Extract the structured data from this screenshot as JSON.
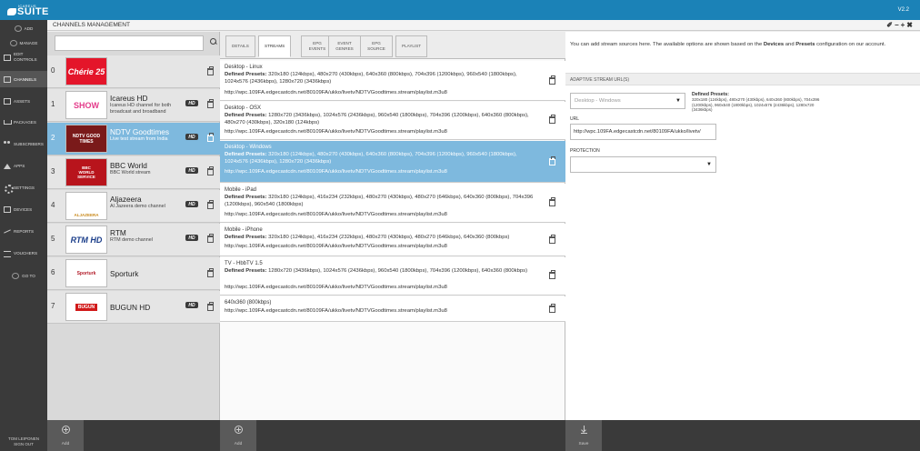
{
  "app": {
    "brand": "ICAREUS",
    "name": "SUITE",
    "version": "V2.2"
  },
  "sidebar": {
    "items": [
      {
        "label": "ADD",
        "icon": "plus-circle-icon"
      },
      {
        "label": "MANAGE",
        "icon": "manage-icon"
      },
      {
        "label": "EDIT CONTROLS",
        "icon": "edit-controls-icon"
      },
      {
        "label": "CHANNELS",
        "icon": "channels-icon"
      },
      {
        "label": "ASSETS",
        "icon": "assets-icon"
      },
      {
        "label": "PACKAGES",
        "icon": "cart-icon"
      },
      {
        "label": "SUBSCRIBERS",
        "icon": "subscribers-icon"
      },
      {
        "label": "APPS",
        "icon": "apps-icon"
      },
      {
        "label": "SETTINGS",
        "icon": "gear-icon"
      },
      {
        "label": "DEVICES",
        "icon": "devices-icon"
      },
      {
        "label": "REPORTS",
        "icon": "reports-icon"
      },
      {
        "label": "VOUCHERS",
        "icon": "vouchers-icon"
      },
      {
        "label": "GO TO",
        "icon": "goto-icon"
      }
    ],
    "user": {
      "name": "TOM LEIPONEN",
      "signout": "SIGN OUT"
    }
  },
  "header": {
    "title": "CHANNELS MANAGEMENT",
    "controls": "✕ − + ✖"
  },
  "channels": {
    "search_value": "",
    "items": [
      {
        "num": "0",
        "name": "",
        "desc": "",
        "hd": false,
        "logo_text": "Chérie 25"
      },
      {
        "num": "1",
        "name": "Icareus HD",
        "desc": "Icareus HD channel for both broadcast and broadband",
        "hd": true,
        "logo_text": "SHOW"
      },
      {
        "num": "2",
        "name": "NDTV Goodtimes",
        "desc": "Live test stream from India",
        "hd": true,
        "logo_text": "NDTV GOOD TIMES"
      },
      {
        "num": "3",
        "name": "BBC World",
        "desc": "BBC World stream",
        "hd": true,
        "logo_text": "BBC WORLD SERVICE"
      },
      {
        "num": "4",
        "name": "Aljazeera",
        "desc": "Al Jazeera demo channel",
        "hd": true,
        "logo_text": "ALJAZEERA"
      },
      {
        "num": "5",
        "name": "RTM",
        "desc": "RTM demo channel",
        "hd": true,
        "logo_text": "RTM HD"
      },
      {
        "num": "6",
        "name": "Sporturk",
        "desc": "",
        "hd": false,
        "logo_text": "Sporturk"
      },
      {
        "num": "7",
        "name": "BUGUN HD",
        "desc": "",
        "hd": true,
        "logo_text": "BUGUN"
      }
    ],
    "add_label": "Add"
  },
  "tabs": [
    {
      "label": "DETAILS"
    },
    {
      "label": "STREAMS"
    },
    {
      "label": "EPG EVENTS"
    },
    {
      "label": "EVENT GENRES"
    },
    {
      "label": "EPG SOURCE"
    },
    {
      "label": "PLAYLIST"
    }
  ],
  "streams": {
    "presets_label": "Defined Presets:",
    "items": [
      {
        "name": "Desktop - Linux",
        "presets": "320x180 (124kbps), 480x270 (430kbps), 640x360 (800kbps), 704x396 (1200kbps), 960x540 (1800kbps), 1024x576 (2436kbps), 1280x720 (3436kbps)",
        "url": "http://wpc.109FA.edgecastcdn.net/80109FA/ukko/livetv/NDTVGoodtimes.stream/playlist.m3u8"
      },
      {
        "name": "Desktop - OSX",
        "presets": "1280x720 (3436kbps), 1024x576 (2436kbps), 960x540 (1800kbps), 704x396 (1200kbps), 640x360 (800kbps), 480x270 (430kbps), 320x180 (124kbps)",
        "url": "http://wpc.109FA.edgecastcdn.net/80109FA/ukko/livetv/NDTVGoodtimes.stream/playlist.m3u8"
      },
      {
        "name": "Desktop - Windows",
        "presets": "320x180 (124kbps), 480x270 (430kbps), 640x360 (800kbps), 704x396 (1200kbps), 960x540 (1800kbps), 1024x576 (2436kbps), 1280x720 (3436kbps)",
        "url": "http://wpc.109FA.edgecastcdn.net/80109FA/ukko/livetv/NDTVGoodtimes.stream/playlist.m3u8"
      },
      {
        "name": "Mobile - iPad",
        "presets": "320x180 (124kbps), 416x234 (232kbps), 480x270 (430kbps), 480x270 (646kbps), 640x360 (800kbps), 704x396 (1200kbps), 960x540 (1800kbps)",
        "url": "http://wpc.109FA.edgecastcdn.net/80109FA/ukko/livetv/NDTVGoodtimes.stream/playlist.m3u8"
      },
      {
        "name": "Mobile - iPhone",
        "presets": "320x180 (124kbps), 416x234 (232kbps), 480x270 (430kbps), 480x270 (646kbps), 640x360 (800kbps)",
        "url": "http://wpc.109FA.edgecastcdn.net/80109FA/ukko/livetv/NDTVGoodtimes.stream/playlist.m3u8"
      },
      {
        "name": "TV - HbbTV 1.5",
        "presets": "1280x720 (3436kbps), 1024x576 (2436kbps), 960x540 (1800kbps), 704x396 (1200kbps), 640x360 (800kbps)",
        "url": "http://wpc.109FA.edgecastcdn.net/80109FA/ukko/livetv/NDTVGoodtimes.stream/playlist.m3u8"
      },
      {
        "name": "640x360 (800kbps)",
        "presets": "",
        "url": "http://wpc.109FA.edgecastcdn.net/80109FA/ukko/livetv/NDTVGoodtimes.stream/playlist.m3u8"
      }
    ],
    "add_label": "Add"
  },
  "detail": {
    "info_parts": [
      "You can add stream sources here. The available options are shown based on the ",
      "Devices",
      " and ",
      "Presets",
      " configuration on our account."
    ],
    "section_title": "ADAPTIVE STREAM URL(S)",
    "device_select": "Desktop - Windows",
    "presets_title": "Defined Presets:",
    "presets_value": "320x180 (124kbps), 480x270 (430kbps), 640x360 (800kbps), 704x396 (1200kbps), 960x540 (1800kbps), 1024x576 (2436kbps), 1280x720 (3436kbps)",
    "url_label": "URL",
    "url_value": "http://wpc.109FA.edgecastcdn.net/80109FA/ukko/livetv/",
    "protection_label": "PROTECTION",
    "protection_value": "",
    "save_label": "Save"
  },
  "colors": {
    "topbar": "#1b82b7",
    "selected_row": "#7eb9de",
    "sidebar": "#3a3a3a"
  }
}
